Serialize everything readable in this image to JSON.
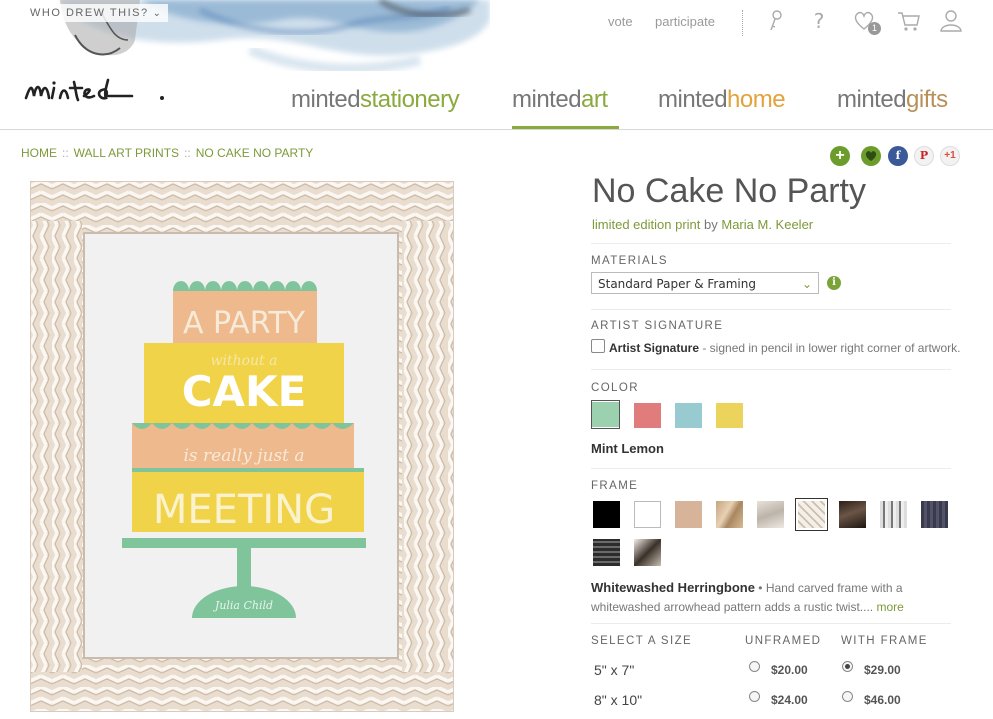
{
  "header": {
    "who_drew": "WHO DREW THIS?",
    "links": {
      "vote": "vote",
      "participate": "participate"
    },
    "icons": [
      "key-icon",
      "help-icon",
      "heart-icon",
      "cart-icon",
      "user-icon"
    ],
    "favorites_count": "1",
    "logo_text": "minted.",
    "brands": [
      {
        "prefix": "minted",
        "suffix": "stationery",
        "color": "#8aaa3d"
      },
      {
        "prefix": "minted",
        "suffix": "art",
        "color": "#8aaa3d",
        "active": true
      },
      {
        "prefix": "minted",
        "suffix": "home",
        "color": "#e2a33d"
      },
      {
        "prefix": "minted",
        "suffix": "gifts",
        "color": "#b99058"
      }
    ]
  },
  "breadcrumb": {
    "home": "HOME",
    "section": "WALL ART PRINTS",
    "current": "NO CAKE NO PARTY",
    "separator": "::"
  },
  "share": {
    "icons": [
      "add-icon",
      "favorite-icon",
      "facebook-icon",
      "pinterest-icon",
      "google-plus-icon"
    ],
    "labels": {
      "facebook": "f",
      "pinterest": "P",
      "google_plus": "+1",
      "add": "+"
    }
  },
  "artwork": {
    "lines": [
      "A PARTY",
      "without a",
      "CAKE",
      "is really just a",
      "MEETING",
      "Julia Child"
    ]
  },
  "product": {
    "title": "No Cake No Party",
    "byline_prefix": "limited edition print",
    "byline_by": "by",
    "artist": "Maria M. Keeler",
    "materials": {
      "label": "MATERIALS",
      "selected": "Standard Paper & Framing",
      "info_icon": "i"
    },
    "signature": {
      "label": "ARTIST SIGNATURE",
      "option_bold": "Artist Signature",
      "option_text": " - signed in pencil in lower right corner of artwork."
    },
    "color": {
      "label": "COLOR",
      "swatches": [
        "#9cd1b0",
        "#e07c7c",
        "#98cbd0",
        "#ecd45c"
      ],
      "selected_name": "Mint Lemon"
    },
    "frame": {
      "label": "FRAME",
      "selected_name": "Whitewashed Herringbone",
      "description": " • Hand carved frame with a whitewashed arrowhead pattern adds a rustic twist....",
      "more": "more"
    },
    "size": {
      "label": "SELECT A SIZE",
      "col_unframed": "UNFRAMED",
      "col_framed": "WITH FRAME",
      "rows": [
        {
          "size": "5\" x 7\"",
          "unframed": "$20.00",
          "framed": "$29.00",
          "selected": "framed"
        },
        {
          "size": "8\" x 10\"",
          "unframed": "$24.00",
          "framed": "$46.00",
          "selected": ""
        }
      ]
    }
  }
}
